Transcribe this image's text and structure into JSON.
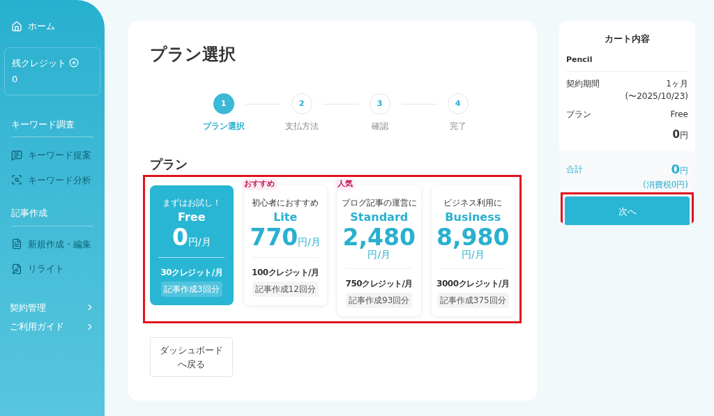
{
  "sidebar": {
    "items": [
      {
        "kind": "link",
        "label": "ホーム",
        "disabled": false
      },
      {
        "kind": "credit",
        "label": "残クレジット",
        "value": "0"
      },
      {
        "kind": "section",
        "label": "キーワード調査"
      },
      {
        "kind": "item",
        "label": "キーワード提案",
        "disabled": true
      },
      {
        "kind": "item",
        "label": "キーワード分析",
        "disabled": true
      },
      {
        "kind": "section",
        "label": "記事作成"
      },
      {
        "kind": "item",
        "label": "新規作成・編集",
        "disabled": true
      },
      {
        "kind": "item",
        "label": "リライト",
        "disabled": true
      },
      {
        "kind": "expand",
        "label": "契約管理",
        "expanded": false
      },
      {
        "kind": "expand",
        "label": "ご利用ガイド",
        "expanded": false
      }
    ]
  },
  "main": {
    "title": "プラン選択",
    "steps": [
      {
        "number": "1",
        "label": "プラン選択",
        "selected": true
      },
      {
        "number": "2",
        "label": "支払方法",
        "selected": false
      },
      {
        "number": "3",
        "label": "確認",
        "selected": false
      },
      {
        "number": "4",
        "label": "完了",
        "selected": false
      }
    ],
    "plans_heading": "プラン",
    "plans_highlighted": true,
    "plans": [
      {
        "tagline": "まずはお試し！",
        "name": "Free",
        "price": "0",
        "unit": "円/月",
        "credits": "30クレジット/月",
        "articles": "記事作成3回分",
        "selected": true
      },
      {
        "badge": "おすすめ",
        "tagline": "初心者におすすめ",
        "name": "Lite",
        "price": "770",
        "unit": "円/月",
        "credits": "100クレジット/月",
        "articles": "記事作成12回分",
        "selected": false
      },
      {
        "badge": "人気",
        "tagline": "ブログ記事の運営に",
        "name": "Standard",
        "price": "2,480",
        "unit": "円/月",
        "credits": "750クレジット/月",
        "articles": "記事作成93回分",
        "selected": false
      },
      {
        "tagline": "ビジネス利用に",
        "name": "Business",
        "price": "8,980",
        "unit": "円/月",
        "credits": "3000クレジット/月",
        "articles": "記事作成375回分",
        "selected": false
      }
    ],
    "back_button": "ダッシュボードへ戻る"
  },
  "cart": {
    "title": "カート内容",
    "product": "Pencil",
    "rows": [
      {
        "label": "契約期間",
        "value": "1ヶ月",
        "sub": "(〜2025/10/23)"
      },
      {
        "label": "プラン",
        "value": "Free"
      }
    ],
    "subtotal": "0",
    "subtotal_unit": "円",
    "total_label": "合計",
    "total": "0",
    "total_unit": "円",
    "tax": "(消費税0円)",
    "next_button": "次へ",
    "next_highlighted": true
  }
}
